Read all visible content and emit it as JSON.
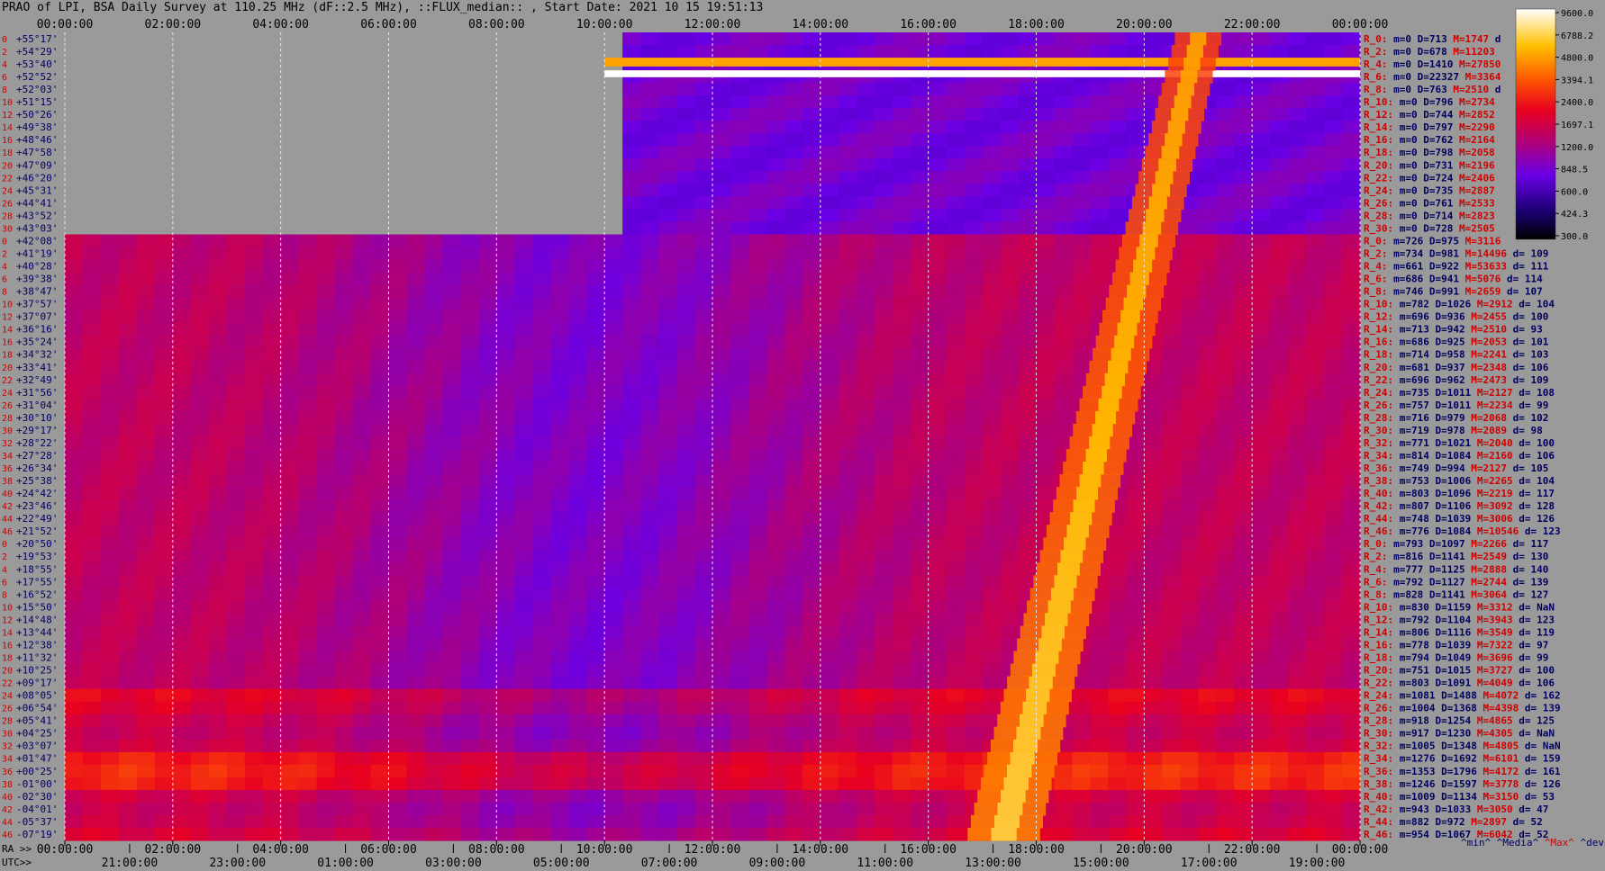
{
  "title": "PRAO of LPI, BSA Daily Survey at 110.25 MHz (dF::2.5 MHz), ::FLUX_median:: , Start Date: 2021 10 15 19:51:13",
  "axis_labels": {
    "ra": "RA >>",
    "utc": "UTC>>"
  },
  "footer": {
    "min": "^min^",
    "median": "^Media^",
    "max": "^Max^",
    "dev": "^devia^"
  },
  "colors": {
    "background": "#9a9a9a",
    "grid": "#e8e8e8",
    "blank": "#9a9a9a",
    "label_red": "#d00000",
    "label_navy": "#000060"
  },
  "chart_data": {
    "type": "heatmap",
    "colormap": "gnuplot-style (black-blue-purple-red-orange-yellow-white)",
    "x_top_ticks": [
      "00:00:00",
      "02:00:00",
      "04:00:00",
      "06:00:00",
      "08:00:00",
      "10:00:00",
      "12:00:00",
      "14:00:00",
      "16:00:00",
      "18:00:00",
      "20:00:00",
      "22:00:00",
      "00:00:00"
    ],
    "x_ra_ticks": [
      "00:00:00",
      "02:00:00",
      "04:00:00",
      "06:00:00",
      "08:00:00",
      "10:00:00",
      "12:00:00",
      "14:00:00",
      "16:00:00",
      "18:00:00",
      "20:00:00",
      "22:00:00",
      "00:00:00"
    ],
    "x_utc_ticks": [
      "21:00:00",
      "23:00:00",
      "01:00:00",
      "03:00:00",
      "05:00:00",
      "07:00:00",
      "09:00:00",
      "11:00:00",
      "13:00:00",
      "15:00:00",
      "17:00:00",
      "19:00:00"
    ],
    "colorbar_ticks": [
      "9600.0",
      "6788.2",
      "4800.0",
      "3394.1",
      "2400.0",
      "1697.1",
      "1200.0",
      "848.5",
      "600.0",
      "424.3",
      "300.0"
    ],
    "dec_labels": [
      "+55°17'",
      "+54°29'",
      "+53°40'",
      "+52°52'",
      "+52°03'",
      "+51°15'",
      "+50°26'",
      "+49°38'",
      "+48°46'",
      "+47°58'",
      "+47°09'",
      "+46°20'",
      "+45°31'",
      "+44°41'",
      "+43°52'",
      "+43°03'",
      "+42°08'",
      "+41°19'",
      "+40°28'",
      "+39°38'",
      "+38°47'",
      "+37°57'",
      "+37°07'",
      "+36°16'",
      "+35°24'",
      "+34°32'",
      "+33°41'",
      "+32°49'",
      "+31°56'",
      "+31°04'",
      "+30°10'",
      "+29°17'",
      "+28°22'",
      "+27°28'",
      "+26°34'",
      "+25°38'",
      "+24°42'",
      "+23°46'",
      "+22°49'",
      "+21°52'",
      "+20°50'",
      "+19°53'",
      "+18°55'",
      "+17°55'",
      "+16°52'",
      "+15°50'",
      "+14°48'",
      "+13°44'",
      "+12°38'",
      "+11°32'",
      "+10°25'",
      "+09°17'",
      "+08°05'",
      "+06°54'",
      "+05°41'",
      "+04°25'",
      "+03°07'",
      "+01°47'",
      "+00°25'",
      "-01°00'",
      "-02°30'",
      "-04°01'",
      "-05°37'",
      "-07°19'"
    ],
    "row_index_labels": [
      "0",
      "2",
      "4",
      "6",
      "8",
      "10",
      "12",
      "14",
      "16",
      "18",
      "20",
      "22",
      "24",
      "26",
      "28",
      "30",
      "0",
      "2",
      "4",
      "6",
      "8",
      "10",
      "12",
      "14",
      "16",
      "18",
      "20",
      "22",
      "24",
      "26",
      "28",
      "30",
      "32",
      "34",
      "36",
      "38",
      "40",
      "42",
      "44",
      "46",
      "0",
      "2",
      "4",
      "6",
      "8",
      "10",
      "12",
      "14",
      "16",
      "18",
      "20",
      "22",
      "24",
      "26",
      "28",
      "30",
      "32",
      "34",
      "36",
      "38",
      "40",
      "42",
      "44",
      "46"
    ],
    "stats_rows": [
      {
        "r": "R_0:",
        "m": "m=0",
        "d": "D=713",
        "M": "M=1747",
        "dv": "d"
      },
      {
        "r": "R_2:",
        "m": "m=0",
        "d": "D=678",
        "M": "M=11203",
        "dv": ""
      },
      {
        "r": "R_4:",
        "m": "m=0",
        "d": "D=1410",
        "M": "M=27850",
        "dv": ""
      },
      {
        "r": "R_6:",
        "m": "m=0",
        "d": "D=22327",
        "M": "M=3364",
        "dv": ""
      },
      {
        "r": "R_8:",
        "m": "m=0",
        "d": "D=763",
        "M": "M=2510",
        "dv": "d"
      },
      {
        "r": "R_10:",
        "m": "m=0",
        "d": "D=796",
        "M": "M=2734",
        "dv": ""
      },
      {
        "r": "R_12:",
        "m": "m=0",
        "d": "D=744",
        "M": "M=2852",
        "dv": ""
      },
      {
        "r": "R_14:",
        "m": "m=0",
        "d": "D=797",
        "M": "M=2290",
        "dv": ""
      },
      {
        "r": "R_16:",
        "m": "m=0",
        "d": "D=762",
        "M": "M=2164",
        "dv": ""
      },
      {
        "r": "R_18:",
        "m": "m=0",
        "d": "D=798",
        "M": "M=2058",
        "dv": ""
      },
      {
        "r": "R_20:",
        "m": "m=0",
        "d": "D=731",
        "M": "M=2196",
        "dv": ""
      },
      {
        "r": "R_22:",
        "m": "m=0",
        "d": "D=724",
        "M": "M=2406",
        "dv": ""
      },
      {
        "r": "R_24:",
        "m": "m=0",
        "d": "D=735",
        "M": "M=2887",
        "dv": ""
      },
      {
        "r": "R_26:",
        "m": "m=0",
        "d": "D=761",
        "M": "M=2533",
        "dv": ""
      },
      {
        "r": "R_28:",
        "m": "m=0",
        "d": "D=714",
        "M": "M=2823",
        "dv": ""
      },
      {
        "r": "R_30:",
        "m": "m=0",
        "d": "D=728",
        "M": "M=2505",
        "dv": ""
      },
      {
        "r": "R_0:",
        "m": "m=726",
        "d": "D=975",
        "M": "M=3116",
        "dv": ""
      },
      {
        "r": "R_2:",
        "m": "m=734",
        "d": "D=981",
        "M": "M=14496",
        "dv": "d= 109"
      },
      {
        "r": "R_4:",
        "m": "m=661",
        "d": "D=922",
        "M": "M=53633",
        "dv": "d= 111"
      },
      {
        "r": "R_6:",
        "m": "m=686",
        "d": "D=941",
        "M": "M=5076",
        "dv": "d= 114"
      },
      {
        "r": "R_8:",
        "m": "m=746",
        "d": "D=991",
        "M": "M=2659",
        "dv": "d= 107"
      },
      {
        "r": "R_10:",
        "m": "m=782",
        "d": "D=1026",
        "M": "M=2912",
        "dv": "d= 104"
      },
      {
        "r": "R_12:",
        "m": "m=696",
        "d": "D=936",
        "M": "M=2455",
        "dv": "d= 100"
      },
      {
        "r": "R_14:",
        "m": "m=713",
        "d": "D=942",
        "M": "M=2510",
        "dv": "d= 93"
      },
      {
        "r": "R_16:",
        "m": "m=686",
        "d": "D=925",
        "M": "M=2053",
        "dv": "d= 101"
      },
      {
        "r": "R_18:",
        "m": "m=714",
        "d": "D=958",
        "M": "M=2241",
        "dv": "d= 103"
      },
      {
        "r": "R_20:",
        "m": "m=681",
        "d": "D=937",
        "M": "M=2348",
        "dv": "d= 106"
      },
      {
        "r": "R_22:",
        "m": "m=696",
        "d": "D=962",
        "M": "M=2473",
        "dv": "d= 109"
      },
      {
        "r": "R_24:",
        "m": "m=735",
        "d": "D=1011",
        "M": "M=2127",
        "dv": "d= 108"
      },
      {
        "r": "R_26:",
        "m": "m=757",
        "d": "D=1011",
        "M": "M=2234",
        "dv": "d= 99"
      },
      {
        "r": "R_28:",
        "m": "m=716",
        "d": "D=979",
        "M": "M=2068",
        "dv": "d= 102"
      },
      {
        "r": "R_30:",
        "m": "m=719",
        "d": "D=978",
        "M": "M=2089",
        "dv": "d= 98"
      },
      {
        "r": "R_32:",
        "m": "m=771",
        "d": "D=1021",
        "M": "M=2040",
        "dv": "d= 100"
      },
      {
        "r": "R_34:",
        "m": "m=814",
        "d": "D=1084",
        "M": "M=2160",
        "dv": "d= 106"
      },
      {
        "r": "R_36:",
        "m": "m=749",
        "d": "D=994",
        "M": "M=2127",
        "dv": "d= 105"
      },
      {
        "r": "R_38:",
        "m": "m=753",
        "d": "D=1006",
        "M": "M=2265",
        "dv": "d= 104"
      },
      {
        "r": "R_40:",
        "m": "m=803",
        "d": "D=1096",
        "M": "M=2219",
        "dv": "d= 117"
      },
      {
        "r": "R_42:",
        "m": "m=807",
        "d": "D=1106",
        "M": "M=3092",
        "dv": "d= 128"
      },
      {
        "r": "R_44:",
        "m": "m=748",
        "d": "D=1039",
        "M": "M=3006",
        "dv": "d= 126"
      },
      {
        "r": "R_46:",
        "m": "m=776",
        "d": "D=1084",
        "M": "M=10546",
        "dv": "d= 123"
      },
      {
        "r": "R_0:",
        "m": "m=793",
        "d": "D=1097",
        "M": "M=2266",
        "dv": "d= 117"
      },
      {
        "r": "R_2:",
        "m": "m=816",
        "d": "D=1141",
        "M": "M=2549",
        "dv": "d= 130"
      },
      {
        "r": "R_4:",
        "m": "m=777",
        "d": "D=1125",
        "M": "M=2888",
        "dv": "d= 140"
      },
      {
        "r": "R_6:",
        "m": "m=792",
        "d": "D=1127",
        "M": "M=2744",
        "dv": "d= 139"
      },
      {
        "r": "R_8:",
        "m": "m=828",
        "d": "D=1141",
        "M": "M=3064",
        "dv": "d= 127"
      },
      {
        "r": "R_10:",
        "m": "m=830",
        "d": "D=1159",
        "M": "M=3312",
        "dv": "d= NaN"
      },
      {
        "r": "R_12:",
        "m": "m=792",
        "d": "D=1104",
        "M": "M=3943",
        "dv": "d= 123"
      },
      {
        "r": "R_14:",
        "m": "m=806",
        "d": "D=1116",
        "M": "M=3549",
        "dv": "d= 119"
      },
      {
        "r": "R_16:",
        "m": "m=778",
        "d": "D=1039",
        "M": "M=7322",
        "dv": "d= 97"
      },
      {
        "r": "R_18:",
        "m": "m=794",
        "d": "D=1049",
        "M": "M=3696",
        "dv": "d= 99"
      },
      {
        "r": "R_20:",
        "m": "m=751",
        "d": "D=1015",
        "M": "M=3727",
        "dv": "d= 100"
      },
      {
        "r": "R_22:",
        "m": "m=803",
        "d": "D=1091",
        "M": "M=4049",
        "dv": "d= 106"
      },
      {
        "r": "R_24:",
        "m": "m=1081",
        "d": "D=1488",
        "M": "M=4072",
        "dv": "d= 162"
      },
      {
        "r": "R_26:",
        "m": "m=1004",
        "d": "D=1368",
        "M": "M=4398",
        "dv": "d= 139"
      },
      {
        "r": "R_28:",
        "m": "m=918",
        "d": "D=1254",
        "M": "M=4865",
        "dv": "d= 125"
      },
      {
        "r": "R_30:",
        "m": "m=917",
        "d": "D=1230",
        "M": "M=4305",
        "dv": "d= NaN"
      },
      {
        "r": "R_32:",
        "m": "m=1005",
        "d": "D=1348",
        "M": "M=4805",
        "dv": "d= NaN"
      },
      {
        "r": "R_34:",
        "m": "m=1276",
        "d": "D=1692",
        "M": "M=6101",
        "dv": "d= 159"
      },
      {
        "r": "R_36:",
        "m": "m=1353",
        "d": "D=1796",
        "M": "M=4172",
        "dv": "d= 161"
      },
      {
        "r": "R_38:",
        "m": "m=1246",
        "d": "D=1597",
        "M": "M=3778",
        "dv": "d= 126"
      },
      {
        "r": "R_40:",
        "m": "m=1009",
        "d": "D=1134",
        "M": "M=3150",
        "dv": "d= 53"
      },
      {
        "r": "R_42:",
        "m": "m=943",
        "d": "D=1033",
        "M": "M=3050",
        "dv": "d= 47"
      },
      {
        "r": "R_44:",
        "m": "m=882",
        "d": "D=972",
        "M": "M=2897",
        "dv": "d= 52"
      },
      {
        "r": "R_46:",
        "m": "m=954",
        "d": "D=1067",
        "M": "M=6042",
        "dv": "d= 52"
      }
    ]
  }
}
